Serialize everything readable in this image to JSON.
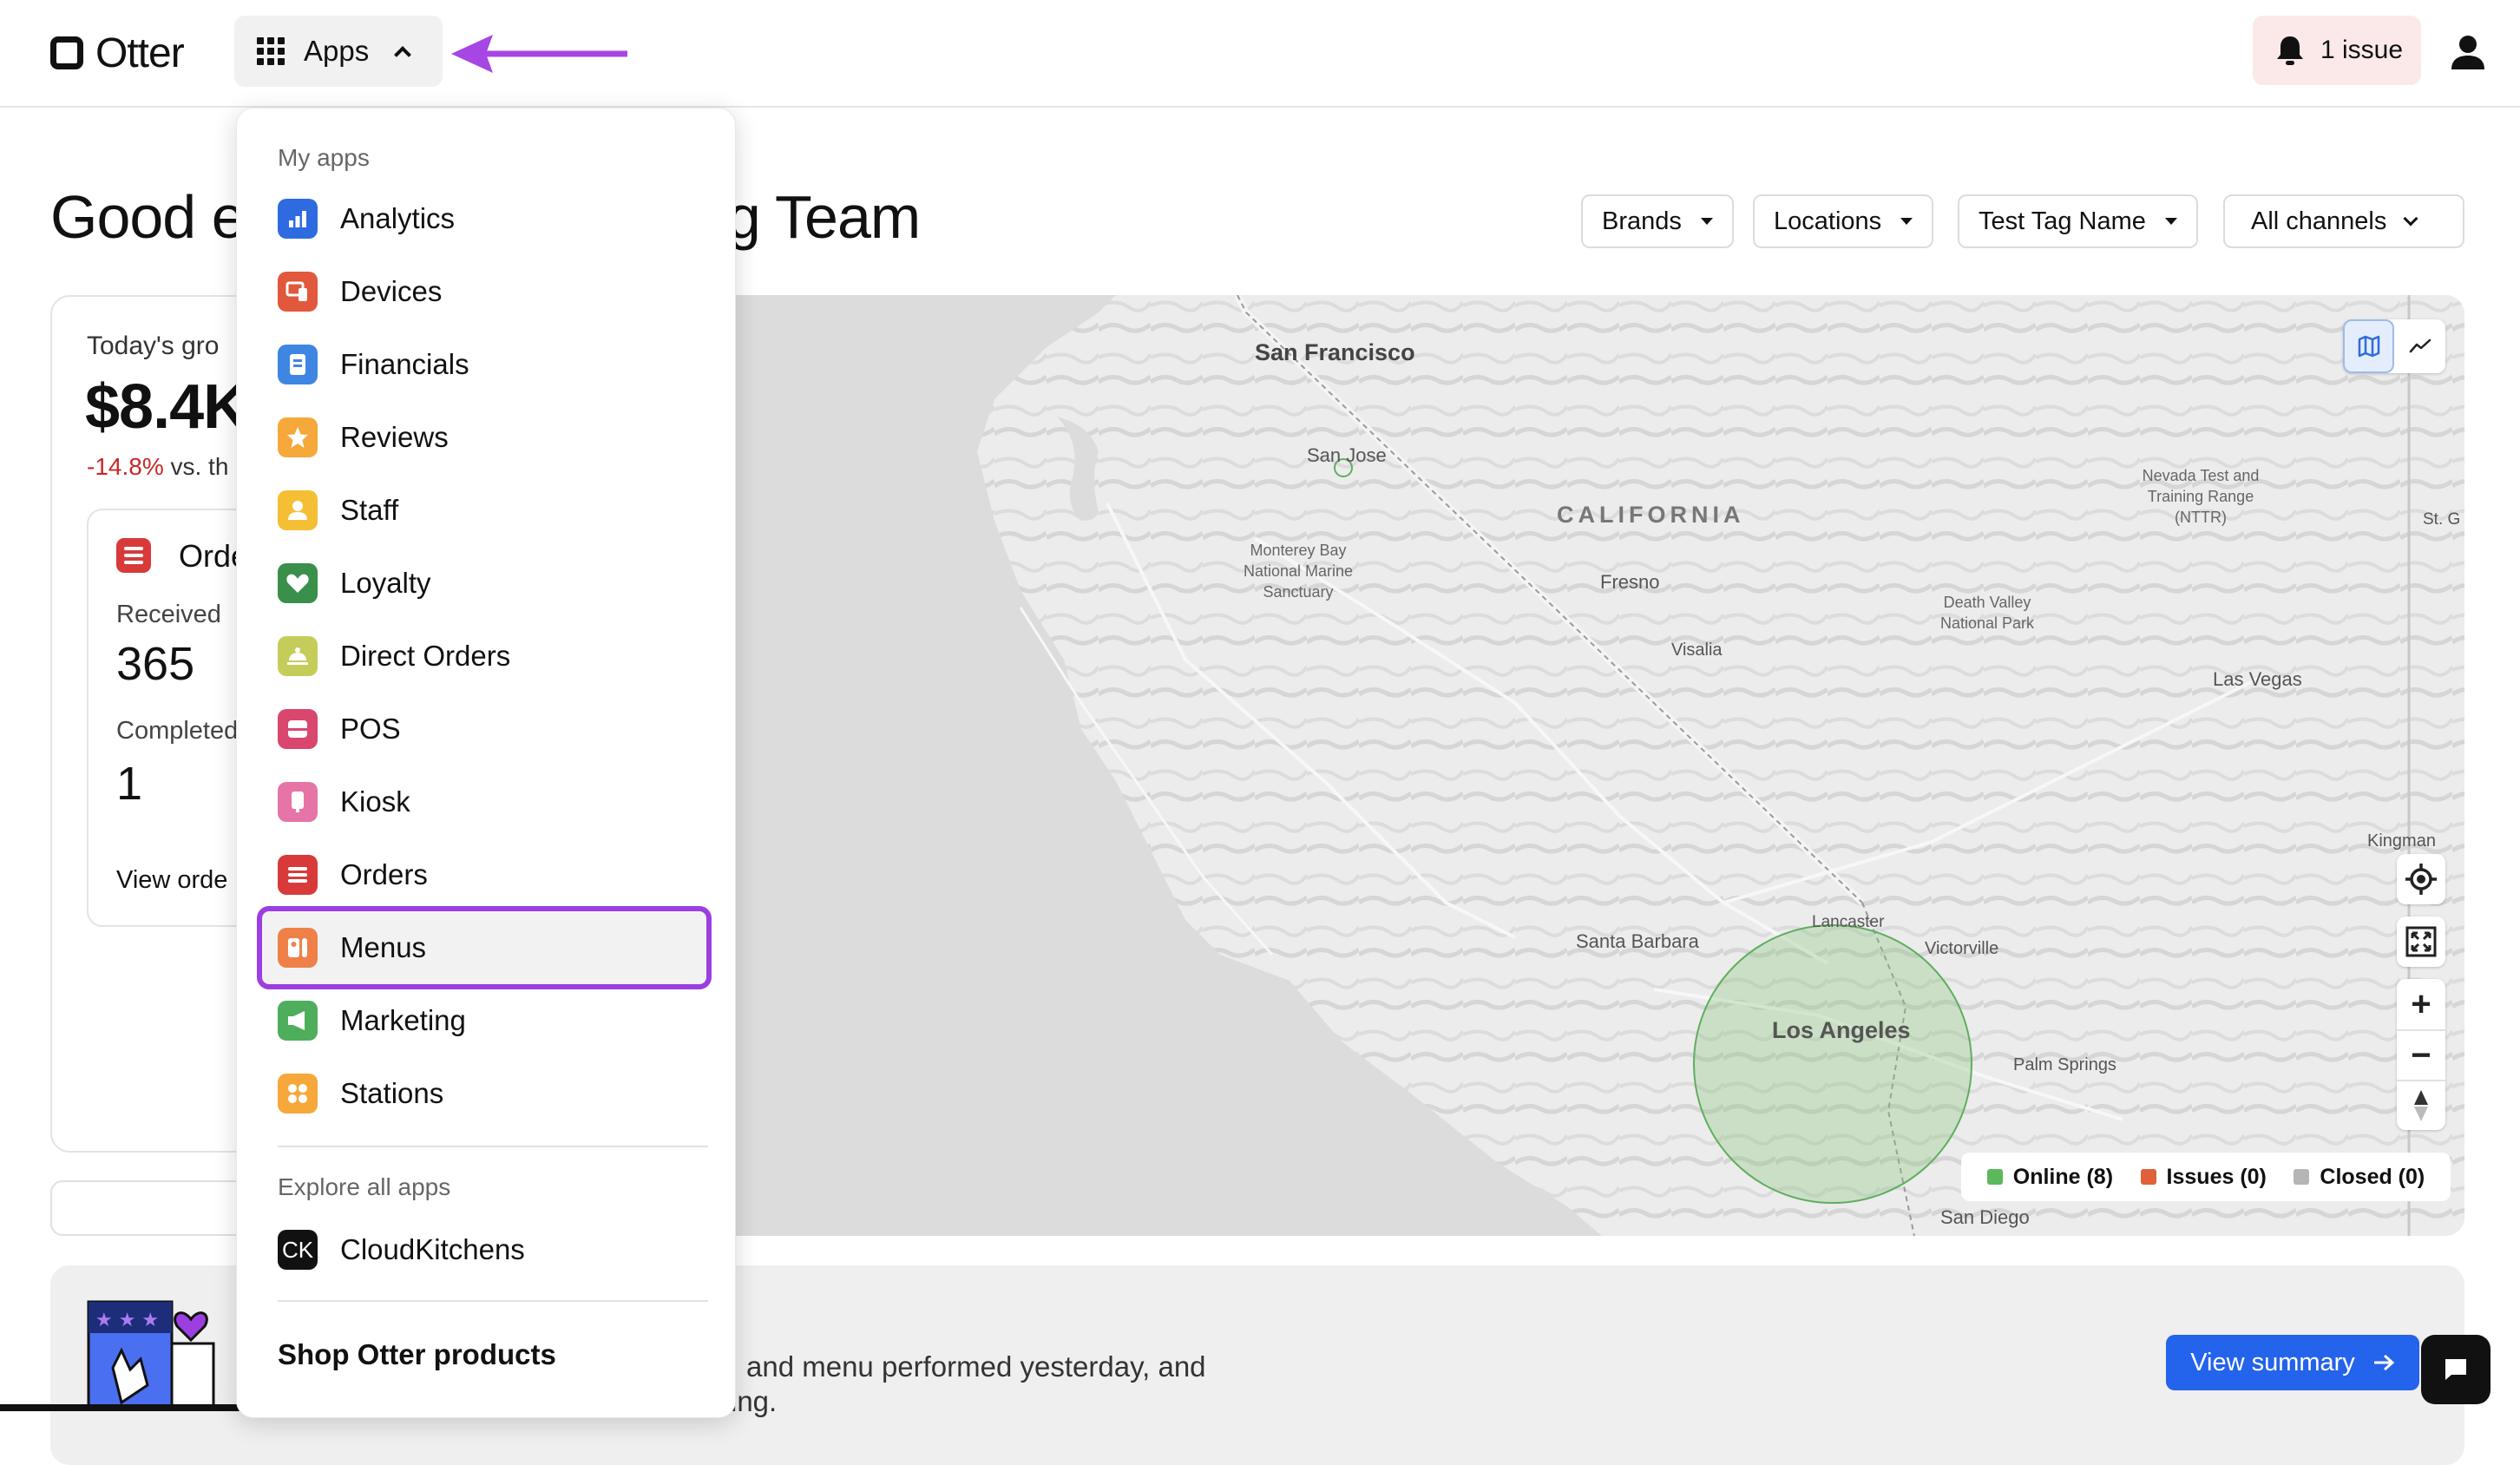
{
  "header": {
    "logo_text": "Otter",
    "apps_label": "Apps",
    "issue_label": "1 issue"
  },
  "dashboard": {
    "greeting_start": "Good e",
    "greeting_end": "ng Team",
    "filters": [
      "Brands",
      "Locations",
      "Test Tag Name",
      "All channels"
    ],
    "sales_label": "Today's gro",
    "sales_value": "$8.4K",
    "sales_delta": "-14.8%",
    "sales_delta_suffix": " vs. th",
    "orders_title": "Orde",
    "received_label": "Received",
    "received_value": "365",
    "completed_label": "Completed",
    "completed_value": "1",
    "view_orders": "View orde"
  },
  "map": {
    "labels": {
      "san_francisco": "San Francisco",
      "san_jose": "San Jose",
      "monterey": "Monterey Bay National Marine Sanctuary",
      "california": "CALIFORNIA",
      "fresno": "Fresno",
      "visalia": "Visalia",
      "nevada_test": "Nevada Test and Training Range (NTTR)",
      "st_g": "St. G",
      "death_valley": "Death Valley National Park",
      "las_vegas": "Las Vegas",
      "kingman": "Kingman",
      "santa_barbara": "Santa Barbara",
      "lancaster": "Lancaster",
      "victorville": "Victorville",
      "los_angeles": "Los Angeles",
      "palm_springs": "Palm Springs",
      "san_diego": "San Diego"
    },
    "legend": [
      {
        "label": "Online (8)",
        "color": "#5cb85c"
      },
      {
        "label": "Issues (0)",
        "color": "#e0603a"
      },
      {
        "label": "Closed (0)",
        "color": "#b5b5b5"
      }
    ],
    "zoom_in": "+",
    "zoom_out": "−"
  },
  "banner": {
    "text_line1": "and menu performed yesterday, and",
    "text_line2": "ing.",
    "button": "View summary"
  },
  "apps_menu": {
    "my_apps_title": "My apps",
    "items": [
      {
        "label": "Analytics",
        "icon": "analytics-icon",
        "color": "#2f6be0"
      },
      {
        "label": "Devices",
        "icon": "devices-icon",
        "color": "#e2583c"
      },
      {
        "label": "Financials",
        "icon": "financials-icon",
        "color": "#3f86e3"
      },
      {
        "label": "Reviews",
        "icon": "star-icon",
        "color": "#f6a83a"
      },
      {
        "label": "Staff",
        "icon": "staff-icon",
        "color": "#f4bf34"
      },
      {
        "label": "Loyalty",
        "icon": "heart-icon",
        "color": "#3a8f4a"
      },
      {
        "label": "Direct Orders",
        "icon": "direct-orders-icon",
        "color": "#c4cd5a"
      },
      {
        "label": "POS",
        "icon": "pos-icon",
        "color": "#d9466e"
      },
      {
        "label": "Kiosk",
        "icon": "kiosk-icon",
        "color": "#e774a6"
      },
      {
        "label": "Orders",
        "icon": "orders-icon",
        "color": "#d83a3a"
      },
      {
        "label": "Menus",
        "icon": "menus-icon",
        "color": "#ef8148"
      },
      {
        "label": "Marketing",
        "icon": "marketing-icon",
        "color": "#4fae5c"
      },
      {
        "label": "Stations",
        "icon": "stations-icon",
        "color": "#f6a83a"
      }
    ],
    "explore_title": "Explore all apps",
    "explore_items": [
      {
        "label": "CloudKitchens",
        "icon_text": "CK"
      }
    ],
    "shop_label": "Shop Otter products"
  }
}
